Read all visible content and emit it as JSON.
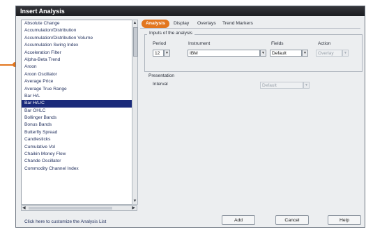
{
  "dialog": {
    "title": "Insert Analysis"
  },
  "list": {
    "items": [
      "Absolute Change",
      "Accumulation/Distribution",
      "Accumulation/Distribution Volume",
      "Accumulation Swing Index",
      "Acceleration Filter",
      "Alpha-Beta Trend",
      "Aroon",
      "Aroon Oscillator",
      "Average Price",
      "Average True Range",
      "Bar H/L",
      "Bar H/L/C",
      "Bar OHLC",
      "Bollinger Bands",
      "Bonus Bands",
      "Butterfly Spread",
      "Candlesticks",
      "Cumulative Vol",
      "Chaikin Money Flow",
      "Chande Oscillator",
      "Commodity Channel Index"
    ],
    "selected_index": 11,
    "customize_link": "Click here to customize the Analysis List"
  },
  "tabs": [
    "Analysis",
    "Display",
    "Overlays",
    "Trend Markers"
  ],
  "inputs_group": {
    "title": "Inputs of the analysis",
    "columns": {
      "period": "Period",
      "instrument": "Instrument",
      "fields": "Fields",
      "action": "Action"
    },
    "period_value": "12",
    "instrument_value": "IBM",
    "fields_value": "Default",
    "action_value": "Overlay"
  },
  "presentation": {
    "title": "Presentation",
    "interval_label": "Interval",
    "interval_value": "Default"
  },
  "buttons": {
    "add": "Add",
    "cancel": "Cancel",
    "help": "Help"
  },
  "colors": {
    "accent": "#e2761e",
    "selection": "#1a2a7a",
    "titlebar": "#1c1d21"
  }
}
